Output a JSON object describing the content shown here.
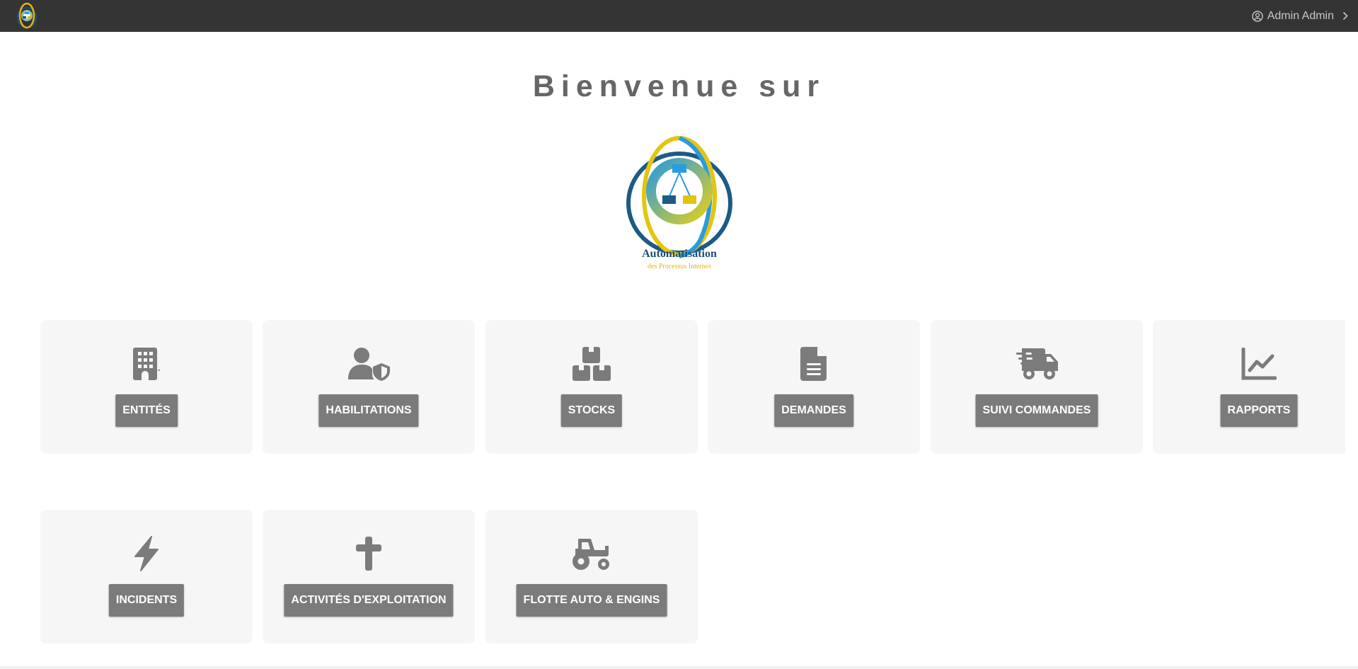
{
  "user": {
    "name": "Admin Admin"
  },
  "welcome": {
    "title": "Bienvenue sur"
  },
  "logo": {
    "title": "Automatisation",
    "subtitle": "des Processus Internes"
  },
  "modules": [
    {
      "label": "ENTITÉS",
      "icon": "building-icon"
    },
    {
      "label": "HABILITATIONS",
      "icon": "user-shield-icon"
    },
    {
      "label": "STOCKS",
      "icon": "boxes-icon"
    },
    {
      "label": "DEMANDES",
      "icon": "file-lines-icon"
    },
    {
      "label": "SUIVI COMMANDES",
      "icon": "truck-fast-icon"
    },
    {
      "label": "RAPPORTS",
      "icon": "chart-line-icon"
    },
    {
      "label": "INCIDENTS",
      "icon": "bolt-icon"
    },
    {
      "label": "ACTIVITÉS D'EXPLOITATION",
      "icon": "cross-icon"
    },
    {
      "label": "FLOTTE AUTO & ENGINS",
      "icon": "tractor-icon"
    }
  ],
  "colors": {
    "topbar": "#343434",
    "card_bg": "#f6f6f6",
    "button": "#7b7b7b",
    "icon": "#7b7b7b",
    "logo_blue": "#1d4f78",
    "logo_yellow": "#e3b50f",
    "logo_light_blue": "#2a9be0"
  }
}
